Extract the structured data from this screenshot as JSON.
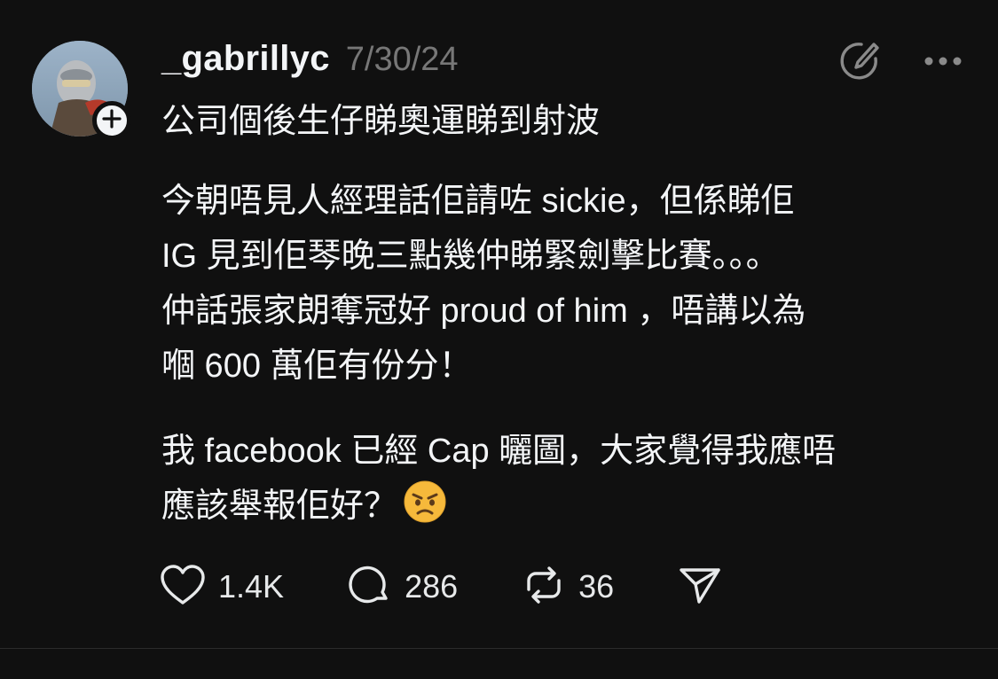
{
  "post": {
    "username": "_gabrillyc",
    "timestamp": "7/30/24",
    "title": "公司個後生仔睇奧運睇到射波",
    "paragraph1": [
      "今朝唔見人經理話佢請咗 sickie，但係睇佢",
      "IG 見到佢琴晚三點幾仲睇緊劍擊比賽。。。",
      "仲話張家朗奪冠好 proud of him ，唔講以為",
      "嗰 600 萬佢有份分！"
    ],
    "paragraph2": [
      "我 facebook 已經 Cap 曬圖，大家覺得我應唔",
      "應該舉報佢好？"
    ],
    "emoji": "angry-face-emoji"
  },
  "actions": {
    "likes": "1.4K",
    "replies": "286",
    "reposts": "36"
  },
  "icons": {
    "follow": "plus-icon",
    "edit": "edit-pencil-icon",
    "more": "more-dots-icon",
    "like": "heart-icon",
    "reply": "comment-bubble-icon",
    "repost": "repost-arrows-icon",
    "share": "send-share-icon"
  },
  "colors": {
    "background": "#101010",
    "text": "#f3f5f7",
    "muted": "#777777",
    "emoji": "#f6b93b"
  }
}
